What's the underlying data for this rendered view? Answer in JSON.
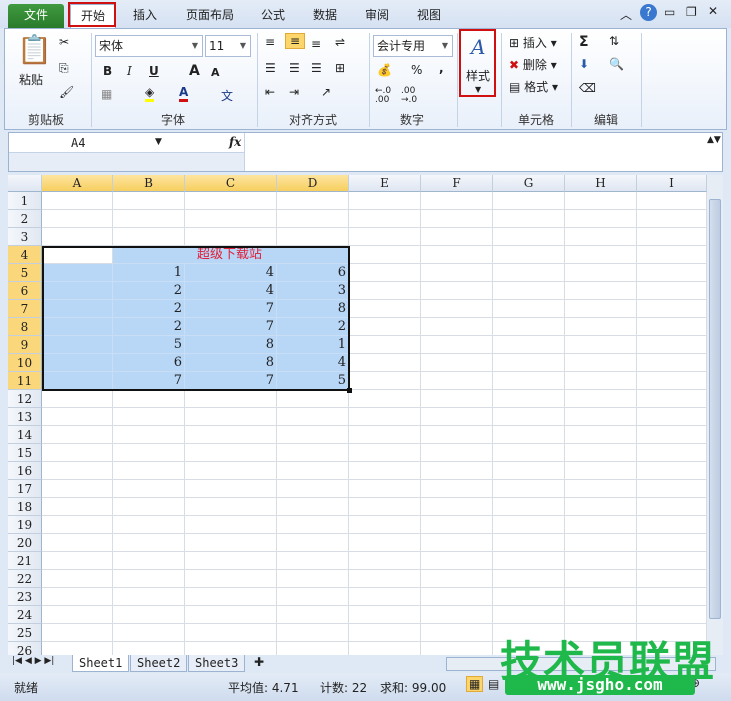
{
  "tabs": [
    "文件",
    "开始",
    "插入",
    "页面布局",
    "公式",
    "数据",
    "审阅",
    "视图"
  ],
  "ribbon": {
    "clipboard": {
      "paste": "粘贴",
      "label": "剪贴板"
    },
    "font": {
      "name": "宋体",
      "size": "11",
      "bold": "B",
      "italic": "I",
      "underline": "U",
      "grow": "A",
      "shrink": "A",
      "color": "A",
      "phonetic": "文",
      "label": "字体"
    },
    "align": {
      "label": "对齐方式"
    },
    "number": {
      "format": "会计专用",
      "percent": "%",
      "comma": ",",
      "inc": "←.0 .00",
      "dec": ".00 →.0",
      "label": "数字"
    },
    "styles": {
      "label": "样式"
    },
    "cells": {
      "insert": "插入",
      "delete": "删除",
      "format": "格式",
      "label": "单元格"
    },
    "editing": {
      "sum": "Σ",
      "label": "编辑"
    }
  },
  "formula_bar": {
    "name_box": "A4",
    "fx": "fx",
    "value": ""
  },
  "columns": [
    "A",
    "B",
    "C",
    "D",
    "E",
    "F",
    "G",
    "H",
    "I"
  ],
  "rows": [
    "1",
    "2",
    "3",
    "4",
    "5",
    "6",
    "7",
    "8",
    "9",
    "10",
    "11",
    "12",
    "13",
    "14",
    "15",
    "16",
    "17",
    "18",
    "19",
    "20",
    "21",
    "22",
    "23",
    "24",
    "25",
    "26"
  ],
  "sheet": {
    "title_cell": "超级下载站",
    "data": [
      [
        1,
        4,
        6
      ],
      [
        2,
        4,
        3
      ],
      [
        2,
        7,
        8
      ],
      [
        2,
        7,
        2
      ],
      [
        5,
        8,
        1
      ],
      [
        6,
        8,
        4
      ],
      [
        7,
        7,
        5
      ]
    ]
  },
  "sheets": [
    "Sheet1",
    "Sheet2",
    "Sheet3"
  ],
  "status": {
    "ready": "就绪",
    "average": "平均值: 4.71",
    "count": "计数: 22",
    "sum": "求和: 99.00"
  },
  "watermark": {
    "title": "技术员联盟",
    "url": "www.jsgho.com"
  },
  "colors": {
    "selection": "#b8d6f6",
    "title_text": "#e0203a",
    "highlight_box": "#d01010"
  }
}
